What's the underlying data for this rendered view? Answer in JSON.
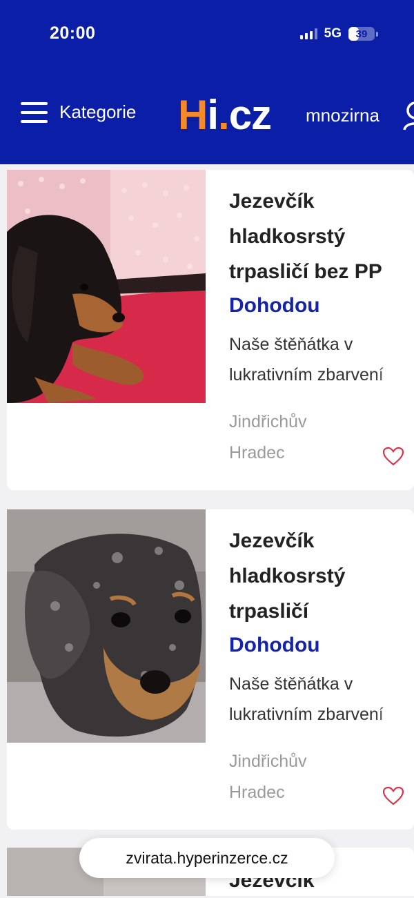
{
  "status_bar": {
    "time": "20:00",
    "network": "5G",
    "battery": "39",
    "battery_level": 0.39
  },
  "header": {
    "menu_label": "Kategorie",
    "logo": {
      "h": "H",
      "i": "i",
      "dot": ".",
      "cz": "cz"
    },
    "username": "mnozirna"
  },
  "listings": [
    {
      "title": "Jezevčík hladkosrstý trpasličí bez PP",
      "price": "Dohodou",
      "description": "Naše štěňátka v lukrativním zbarvení",
      "location": "Jindřichův Hradec"
    },
    {
      "title": "Jezevčík hladkosrstý trpasličí",
      "price": "Dohodou",
      "description": "Naše štěňátka v lukrativním zbarvení",
      "location": "Jindřichův Hradec"
    },
    {
      "title": "Jezevčík"
    }
  ],
  "browser": {
    "url": "zvirata.hyperinzerce.cz"
  },
  "colors": {
    "brand_blue": "#0a1ea8",
    "logo_orange": "#f58a2a",
    "price_blue": "#1523a6",
    "heart_red": "#d9334a"
  }
}
